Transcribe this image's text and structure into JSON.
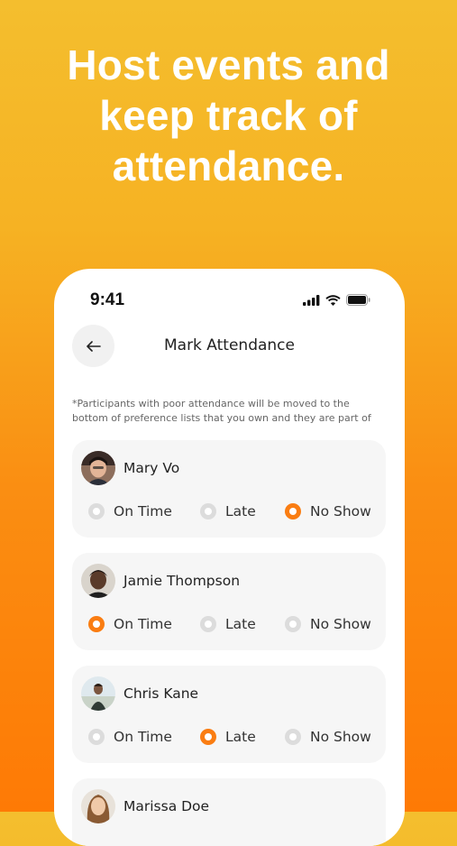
{
  "headline": [
    "Host events and",
    "keep track of",
    "attendance."
  ],
  "status": {
    "time": "9:41"
  },
  "screen": {
    "title": "Mark Attendance",
    "back_icon": "arrow-left-icon",
    "notice": "*Participants with poor attendance will be moved to the bottom of preference lists that you own and they are part of"
  },
  "options": [
    "On Time",
    "Late",
    "No Show"
  ],
  "participants": [
    {
      "name": "Mary Vo",
      "selected": "No Show"
    },
    {
      "name": "Jamie Thompson",
      "selected": "On Time"
    },
    {
      "name": "Chris Kane",
      "selected": "Late"
    },
    {
      "name": "Marissa Doe",
      "selected": ""
    }
  ],
  "colors": {
    "accent": "#FA7D12",
    "gradient_top": "#F4BE2E",
    "gradient_bottom": "#FE7A05"
  }
}
